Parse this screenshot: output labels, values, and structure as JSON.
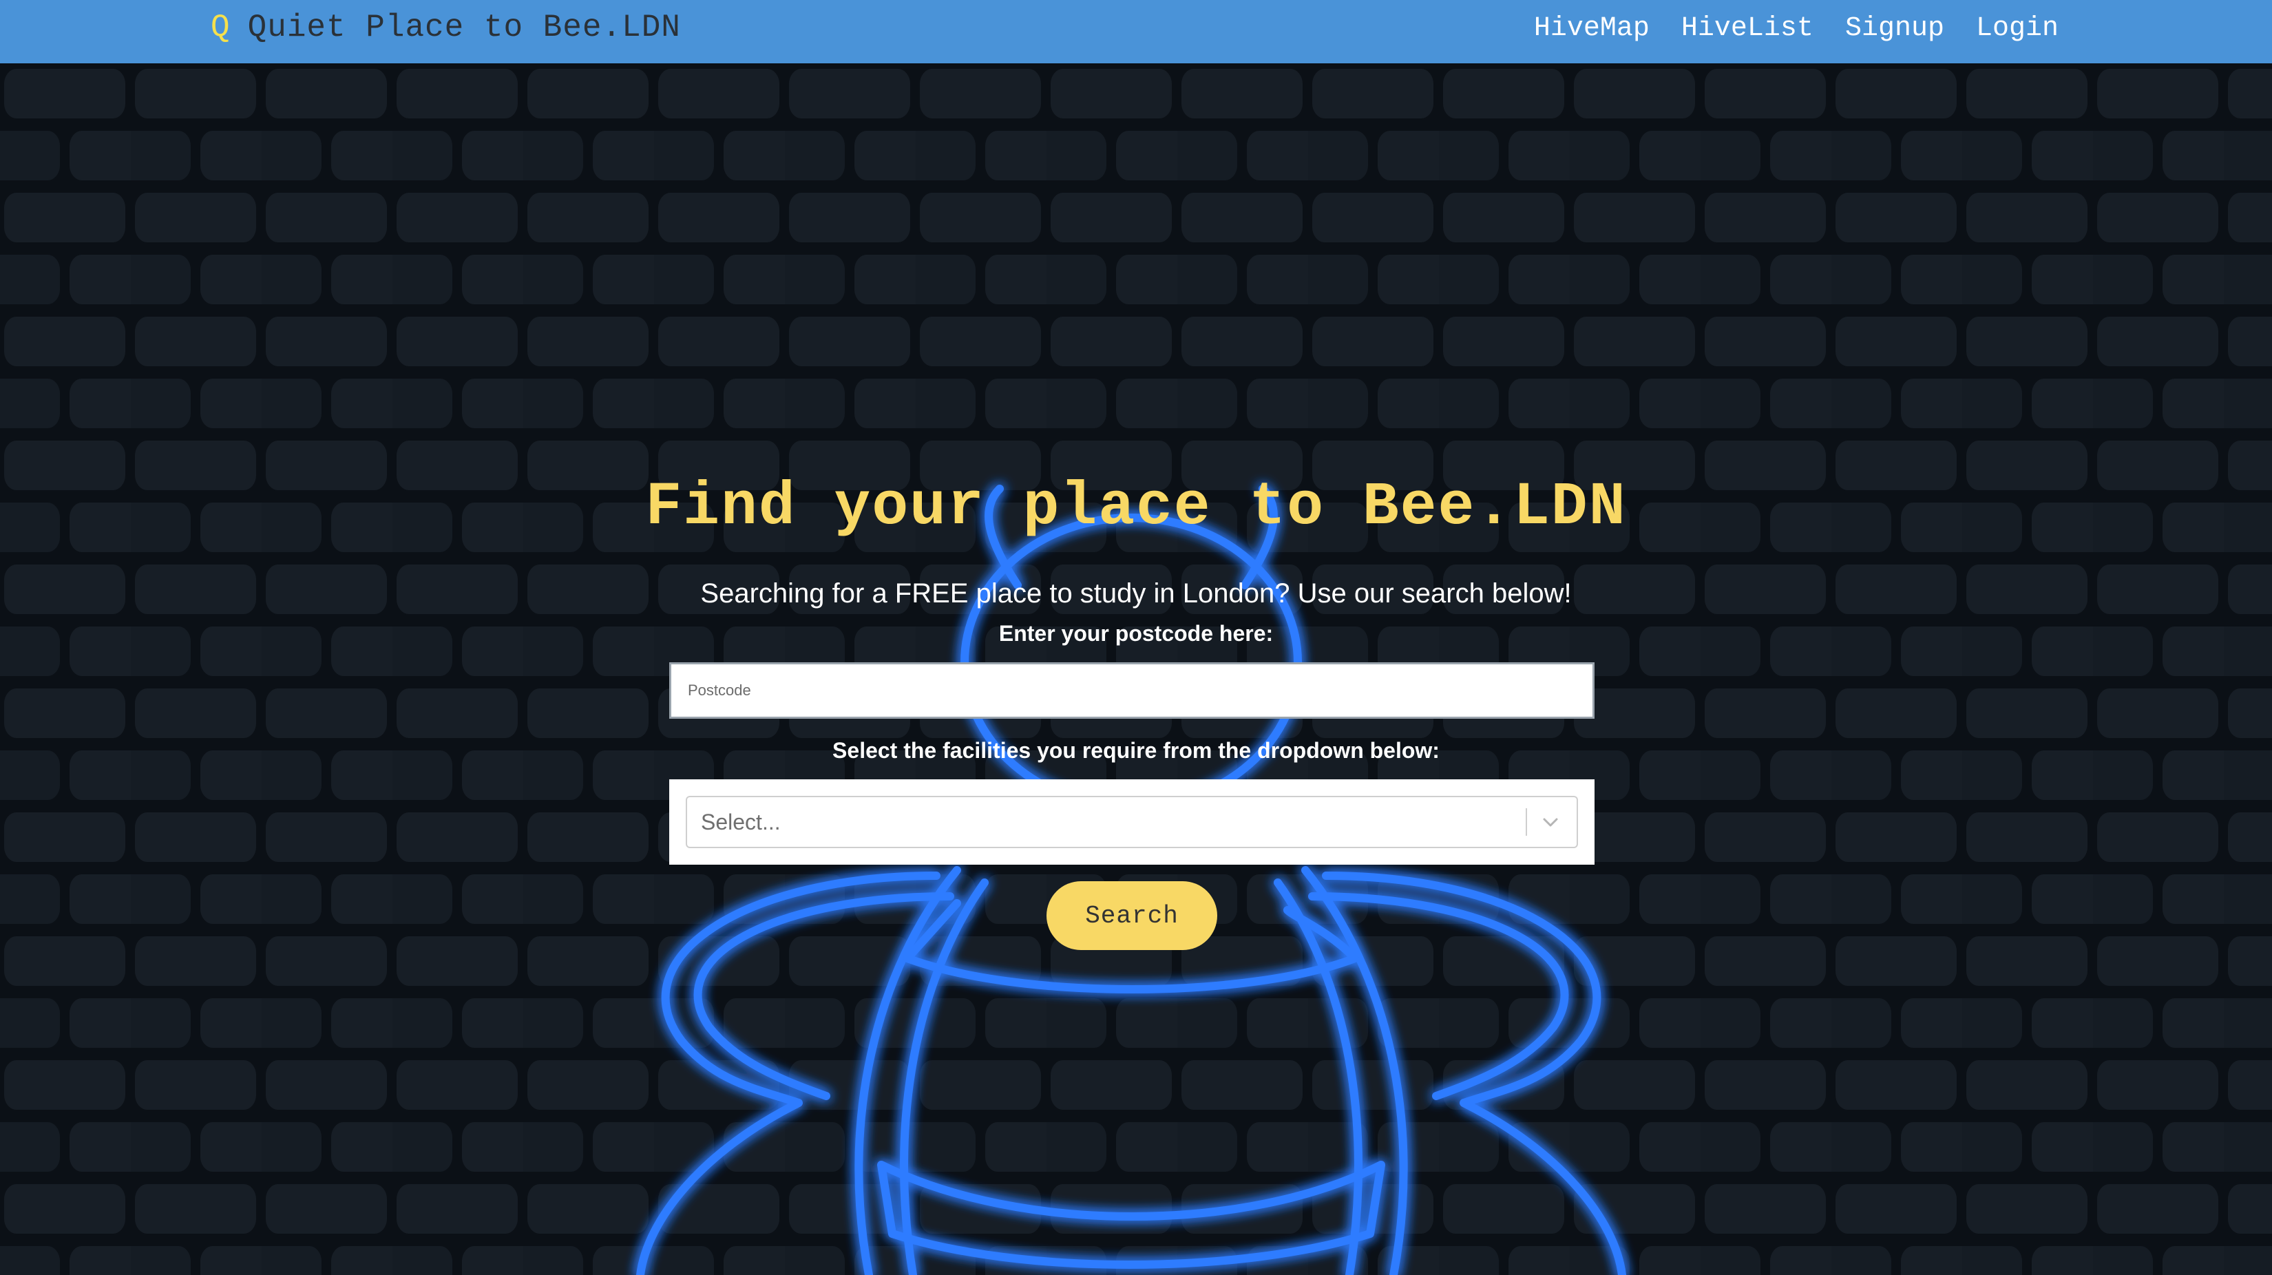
{
  "navbar": {
    "brand_icon": "Q",
    "brand_title": "Quiet Place to Bee.LDN",
    "links": [
      "HiveMap",
      "HiveList",
      "Signup",
      "Login"
    ],
    "background_color": "#4a93d8"
  },
  "hero": {
    "title": "Find your place to Bee.LDN",
    "subtitle": "Searching for a FREE place to study in London? Use our search below!",
    "postcode_label": "Enter your postcode here:",
    "postcode_placeholder": "Postcode",
    "facilities_label": "Select the facilities you require from the dropdown below:",
    "facilities_placeholder": "Select...",
    "search_label": "Search",
    "accent_color": "#f8d865",
    "neon_color": "#2f7bff"
  },
  "icons": {
    "dropdown_indicator": "chevron-down-icon",
    "background_decoration": "neon-bee-icon"
  }
}
